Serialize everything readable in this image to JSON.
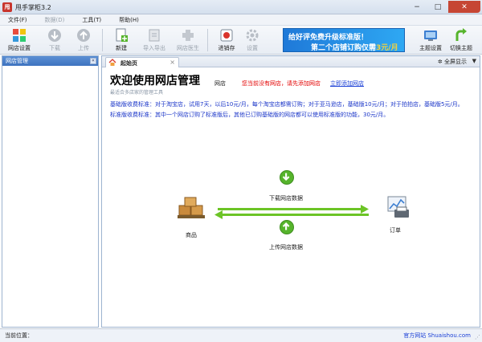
{
  "window": {
    "title": "甩手掌柜3.2",
    "app_icon": "甩"
  },
  "menu": [
    {
      "label": "文件(F)",
      "disabled": false
    },
    {
      "label": "数据(D)",
      "disabled": true
    },
    {
      "label": "工具(T)",
      "disabled": false
    },
    {
      "label": "帮助(H)",
      "disabled": false
    }
  ],
  "toolbar": {
    "shop_settings": "网店设置",
    "download": "下载",
    "upload": "上传",
    "new": "新建",
    "import_export": "导入导出",
    "shop_doctor": "网店医生",
    "inventory": "进销存",
    "settings": "设置",
    "theme_settings": "主题设置",
    "switch_theme": "切换主题"
  },
  "banner": {
    "line1": "给好评免费升级标准版！",
    "line2_prefix": "第二个店铺订购仅需",
    "line2_price": "3元/月"
  },
  "sidebar": {
    "title": "网店管理",
    "pin": "«"
  },
  "tab": {
    "label": "起始页",
    "close": "×"
  },
  "fullscreen": {
    "label": "全屏显示",
    "arrow": "▼"
  },
  "welcome": {
    "title": "欢迎使用网店管理",
    "subtitle": "最适合多店家的管理工具",
    "store_label": "网店",
    "store_warning": "您当前没有网店，请先添加网店",
    "store_add_link": "立即添加网店"
  },
  "fees": {
    "basic": "基础版收费标准：对于淘宝店，试用7天，以后10元/月，每个淘宝店都需订购；对于亚马逊店，基础版10元/月；对于拍拍店，基础版5元/月。",
    "standard": "标准版收费标准：其中一个网店订购了标准版后，其他已订购基础版的网店都可以使用标准版的功能，30元/月。"
  },
  "flow": {
    "download_label": "下载网店数据",
    "upload_label": "上传网店数据",
    "goods_label": "商品",
    "orders_label": "订单"
  },
  "status": {
    "left": "当前位置：",
    "right": "官方网站 Shuaishou.com",
    "grip": "⋰"
  },
  "colors": {
    "accent": "#3e73bf",
    "flow_green": "#6cc426",
    "warning_red": "#e30000",
    "link_blue": "#1a3fd6",
    "fee_blue": "#1a35c8"
  }
}
